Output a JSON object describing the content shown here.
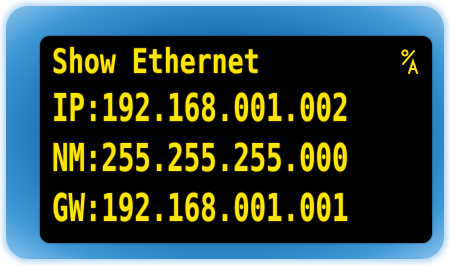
{
  "display": {
    "title": "Show Ethernet",
    "mode_icon": "alpha-numeric-mode-icon",
    "rows": [
      {
        "label": "IP:",
        "value": "192.168.001.002"
      },
      {
        "label": "NM:",
        "value": "255.255.255.000"
      },
      {
        "label": "GW:",
        "value": "192.168.001.001"
      }
    ],
    "colors": {
      "text": "#ffe600",
      "screen": "#000000",
      "bezel": "#1a73b5"
    }
  }
}
